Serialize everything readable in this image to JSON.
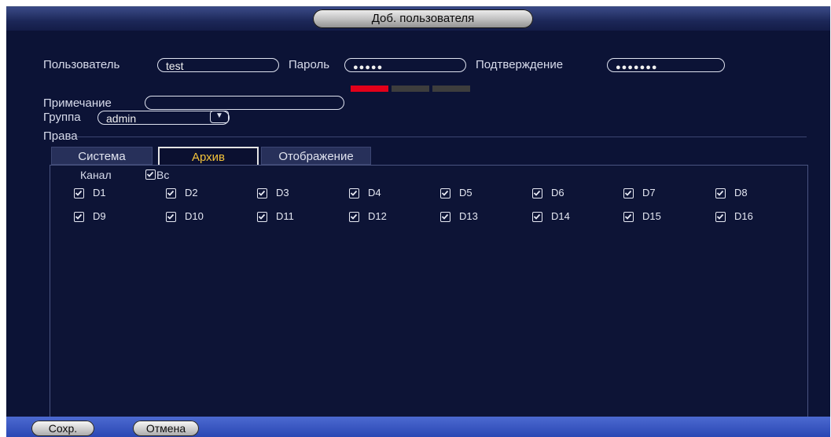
{
  "window": {
    "title": "Доб. пользователя"
  },
  "form": {
    "user_label": "Пользователь",
    "user_value": "test",
    "password_label": "Пароль",
    "password_value": "●●●●●",
    "confirm_label": "Подтверждение",
    "confirm_value": "●●●●●●●",
    "password_strength_level": 1,
    "password_strength_max": 3,
    "note_label": "Примечание",
    "note_value": "",
    "group_label": "Группа",
    "group_value": "admin",
    "rights_label": "Права"
  },
  "tabs": [
    {
      "label": "Система",
      "active": false
    },
    {
      "label": "Архив",
      "active": true
    },
    {
      "label": "Отображение",
      "active": false
    }
  ],
  "channels": {
    "channel_label": "Канал",
    "all_label": "Вс",
    "all_checked": true,
    "items": [
      {
        "label": "D1",
        "checked": true
      },
      {
        "label": "D2",
        "checked": true
      },
      {
        "label": "D3",
        "checked": true
      },
      {
        "label": "D4",
        "checked": true
      },
      {
        "label": "D5",
        "checked": true
      },
      {
        "label": "D6",
        "checked": true
      },
      {
        "label": "D7",
        "checked": true
      },
      {
        "label": "D8",
        "checked": true
      },
      {
        "label": "D9",
        "checked": true
      },
      {
        "label": "D10",
        "checked": true
      },
      {
        "label": "D11",
        "checked": true
      },
      {
        "label": "D12",
        "checked": true
      },
      {
        "label": "D13",
        "checked": true
      },
      {
        "label": "D14",
        "checked": true
      },
      {
        "label": "D15",
        "checked": true
      },
      {
        "label": "D16",
        "checked": true
      }
    ]
  },
  "buttons": {
    "save": "Сохр.",
    "cancel": "Отмена"
  },
  "colors": {
    "background": "#0c1336",
    "active_tab": "#f2c23a",
    "strength_weak": "#e2001a",
    "footer": "#3a57c4"
  }
}
